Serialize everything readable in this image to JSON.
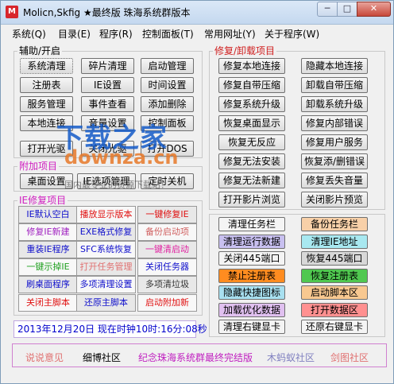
{
  "window": {
    "title": "Molicn,Skfig ★最终版 珠海系统群版本",
    "min_glyph": "─",
    "max_glyph": "□",
    "close_glyph": "✕"
  },
  "menu": [
    "系统(Q)",
    "目录(E)",
    "程序(R)",
    "控制面板(T)",
    "常用网址(Y)",
    "关于程序(W)"
  ],
  "aux": {
    "label": "辅助/开启",
    "buttons": [
      "系统清理",
      "碎片清理",
      "启动管理",
      "注册表",
      "IE设置",
      "时间设置",
      "服务管理",
      "事件查看",
      "添加删除",
      "本地连接",
      "音量设置",
      "控制面板",
      "打开光驱",
      "关闭光驱",
      "打开DOS"
    ]
  },
  "extra": {
    "label": "附加项目",
    "buttons": [
      "桌面设置",
      "IE选项管理",
      "定时关机"
    ]
  },
  "ie": {
    "label": "IE修复项目",
    "cells": [
      {
        "text": "IE默认空白",
        "color": "#1010cc"
      },
      {
        "text": "播放显示版本",
        "color": "#e01010"
      },
      {
        "text": "一键修复IE",
        "color": "#e01010"
      },
      {
        "text": "修复IE新建",
        "color": "#a020c0"
      },
      {
        "text": "EXE格式修复",
        "color": "#1010cc"
      },
      {
        "text": "备份启动项",
        "color": "#d06060"
      },
      {
        "text": "重装IE程序",
        "color": "#1010cc"
      },
      {
        "text": "SFC系统恢复",
        "color": "#1010cc"
      },
      {
        "text": "一键清启动",
        "color": "#e020a0"
      },
      {
        "text": "一键示掉IE",
        "color": "#20a020"
      },
      {
        "text": "打开任务管理",
        "color": "#e07070"
      },
      {
        "text": "关闭任务器",
        "color": "#1010cc"
      },
      {
        "text": "刷桌面程序",
        "color": "#1010cc"
      },
      {
        "text": "多项清理设置",
        "color": "#1010cc"
      },
      {
        "text": "多项清垃圾",
        "color": "#333333"
      },
      {
        "text": "关闭主脚本",
        "color": "#e01010"
      },
      {
        "text": "还原主脚本",
        "color": "#1010cc"
      },
      {
        "text": "启动附加新",
        "color": "#e01010"
      }
    ]
  },
  "repair": {
    "label": "修复/卸载项目",
    "buttons": [
      "修复本地连接",
      "隐藏本地连接",
      "修复自带压缩",
      "卸载自带压缩",
      "修复系统升级",
      "卸载系统升级",
      "恢复桌面显示",
      "修复内部错误",
      "恢复无反应",
      "修复用户服务",
      "修复无法安装",
      "恢复添/删错误",
      "修复无法新建",
      "修复丢失音量",
      "打开影片浏览",
      "关闭影片预览"
    ]
  },
  "tasks": {
    "buttons": [
      {
        "text": "清理任务栏",
        "bg": "#f4f4f4"
      },
      {
        "text": "备份任务栏",
        "bg": "#f8d0a8"
      },
      {
        "text": "清理运行数据",
        "bg": "#c8c0f0"
      },
      {
        "text": "清理IE地址",
        "bg": "#a8e8f0"
      },
      {
        "text": "关闭445端口",
        "bg": "#f4f4f4"
      },
      {
        "text": "恢复445端口",
        "bg": "#d8d8d8"
      },
      {
        "text": "禁止注册表",
        "bg": "#ff8c20"
      },
      {
        "text": "恢复注册表",
        "bg": "#50c850"
      },
      {
        "text": "隐藏快捷图标",
        "bg": "#a8e0f0"
      },
      {
        "text": "启动脚本区",
        "bg": "#f8c890"
      },
      {
        "text": "加载优化数据",
        "bg": "#e0c0f0"
      },
      {
        "text": "打开数据区",
        "bg": "#ff9090"
      },
      {
        "text": "清理右键显卡",
        "bg": "#f4f4f4"
      },
      {
        "text": "还原右键显卡",
        "bg": "#f4f4f4"
      }
    ]
  },
  "status": "2013年12月20日  现在时钟10时:16分:08秒",
  "links": [
    {
      "text": "说说意见",
      "color": "#e07070"
    },
    {
      "text": "细博社区",
      "color": "#000000"
    },
    {
      "text": "纪念珠海系统群最终完结版",
      "color": "#c020c0"
    },
    {
      "text": "木蚂蚁社区",
      "color": "#8080c0"
    },
    {
      "text": "剑图社区",
      "color": "#e07070"
    }
  ],
  "watermark": {
    "line1": "下载之家",
    "line2": "downza.cn",
    "line3": "国内最专业的资源下载站！"
  }
}
